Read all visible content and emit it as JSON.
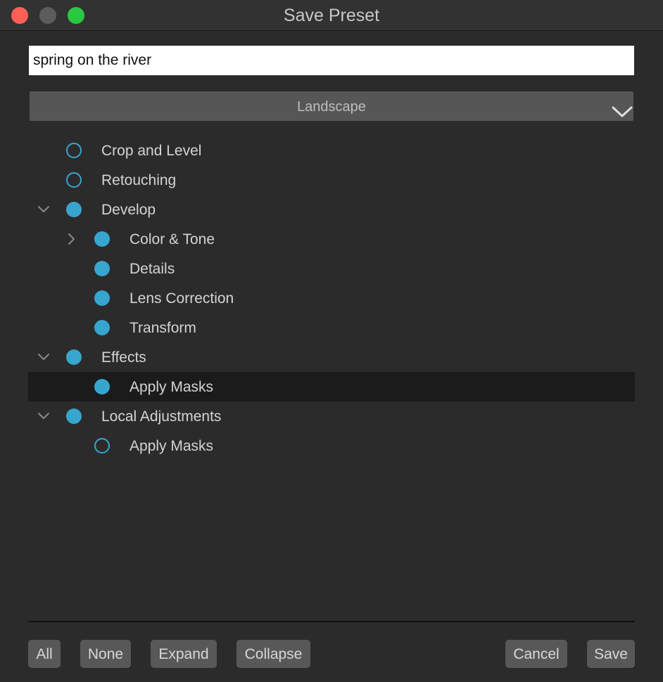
{
  "window": {
    "title": "Save Preset"
  },
  "preset_name": {
    "value": "spring on the river"
  },
  "category": {
    "selected": "Landscape"
  },
  "tree": {
    "items": [
      {
        "label": "Crop and Level",
        "checked": false,
        "level": 0,
        "expander": "none"
      },
      {
        "label": "Retouching",
        "checked": false,
        "level": 0,
        "expander": "none"
      },
      {
        "label": "Develop",
        "checked": true,
        "level": 0,
        "expander": "expanded"
      },
      {
        "label": "Color & Tone",
        "checked": true,
        "level": 1,
        "expander": "collapsed"
      },
      {
        "label": "Details",
        "checked": true,
        "level": 1,
        "expander": "none"
      },
      {
        "label": "Lens Correction",
        "checked": true,
        "level": 1,
        "expander": "none"
      },
      {
        "label": "Transform",
        "checked": true,
        "level": 1,
        "expander": "none"
      },
      {
        "label": "Effects",
        "checked": true,
        "level": 0,
        "expander": "expanded"
      },
      {
        "label": "Apply Masks",
        "checked": true,
        "level": 1,
        "expander": "none",
        "selected": true
      },
      {
        "label": "Local Adjustments",
        "checked": true,
        "level": 0,
        "expander": "expanded"
      },
      {
        "label": "Apply Masks",
        "checked": false,
        "level": 1,
        "expander": "none"
      }
    ]
  },
  "buttons": {
    "all": "All",
    "none": "None",
    "expand": "Expand",
    "collapse": "Collapse",
    "cancel": "Cancel",
    "save": "Save"
  },
  "colors": {
    "accent": "#37a6cf",
    "close": "#fe5f57",
    "minimize": "#5c5c5c",
    "maximize": "#28c840"
  },
  "icons": {
    "expanded": "chevron-down-icon",
    "collapsed": "chevron-right-icon",
    "dropdown": "chevron-down-icon"
  }
}
